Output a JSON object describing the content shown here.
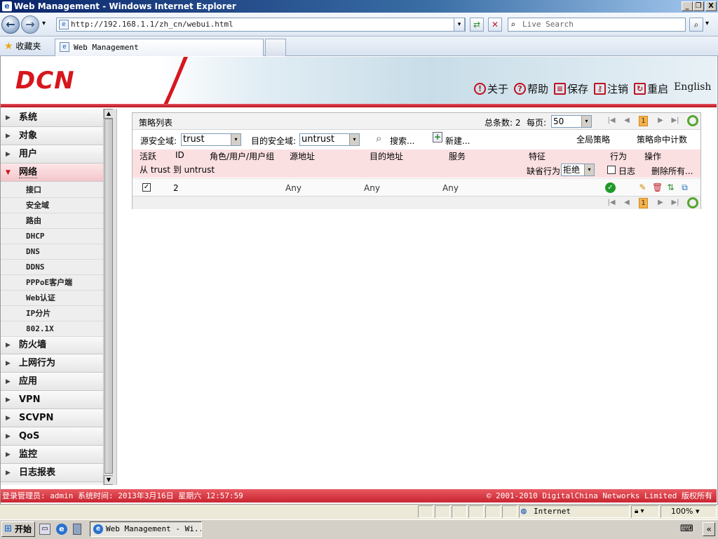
{
  "window": {
    "title": "Web Management - Windows Internet Explorer",
    "minimize": "_",
    "restore": "❐",
    "close": "X"
  },
  "browser": {
    "back": "←",
    "forward": "→",
    "history": "▾",
    "address": "http://192.168.1.1/zh_cn/webui.html",
    "address_icon": "e",
    "address_dropdown": "▾",
    "refresh": "⇄",
    "stop": "✕",
    "search_placeholder": "Live Search",
    "search_button": "⌕",
    "search_options": "▾",
    "favorites_label": "收藏夹",
    "favorites_icon": "★",
    "tab_title": "Web Management",
    "tab_icon": "e"
  },
  "header": {
    "logo": "DCN",
    "links": [
      {
        "icon": "!",
        "label": "关于"
      },
      {
        "icon": "?",
        "label": "帮助"
      },
      {
        "icon": "≡",
        "label": "保存"
      },
      {
        "icon": "⚷",
        "label": "注销"
      },
      {
        "icon": "↻",
        "label": "重启"
      }
    ],
    "language": "English"
  },
  "sidebar": {
    "items": [
      {
        "label": "系统",
        "arrow": "▶"
      },
      {
        "label": "对象",
        "arrow": "▶"
      },
      {
        "label": "用户",
        "arrow": "▶"
      },
      {
        "label": "网络",
        "arrow": "▼"
      },
      {
        "label": "防火墙",
        "arrow": "▶"
      },
      {
        "label": "上网行为",
        "arrow": "▶"
      },
      {
        "label": "应用",
        "arrow": "▶"
      },
      {
        "label": "VPN",
        "arrow": "▶"
      },
      {
        "label": "SCVPN",
        "arrow": "▶"
      },
      {
        "label": "QoS",
        "arrow": "▶"
      },
      {
        "label": "监控",
        "arrow": "▶"
      },
      {
        "label": "日志报表",
        "arrow": "▶"
      }
    ],
    "subitems": [
      "接口",
      "安全域",
      "路由",
      "DHCP",
      "DNS",
      "DDNS",
      "PPPoE客户端",
      "Web认证",
      "IP分片",
      "802.1X"
    ],
    "scroll_up": "▲",
    "scroll_down": "▼"
  },
  "policy": {
    "title": "策略列表",
    "total_label": "总条数: 2",
    "per_page_label": "每页:",
    "per_page_value": "50",
    "dropdown_arrow": "▾",
    "current_page": "1",
    "pager": {
      "first": "|◀",
      "prev": "◀",
      "next": "▶",
      "last": "▶|"
    },
    "src_zone_label": "源安全域:",
    "src_zone_value": "trust",
    "dst_zone_label": "目的安全域:",
    "dst_zone_value": "untrust",
    "search_icon": "⌕",
    "search_label": "搜索...",
    "new_icon": "+",
    "new_label": "新建...",
    "global_policy": "全局策略",
    "hit_count": "策略命中计数",
    "columns": [
      "活跃",
      "ID",
      "角色/用户/用户组",
      "源地址",
      "目的地址",
      "服务",
      "特征",
      "行为",
      "操作"
    ],
    "group_label": "从 trust 到 untrust",
    "default_action_label": "缺省行为",
    "default_action_value": "拒绝",
    "log_label": "日志",
    "delete_all": "删除所有...",
    "rows": [
      {
        "active": "✓",
        "id": "2",
        "src": "Any",
        "dst": "Any",
        "service": "Any",
        "action": "✓"
      }
    ],
    "op_icons": {
      "edit": "✎",
      "delete": "🗑",
      "move": "⇅",
      "copy": "⧉"
    }
  },
  "status": {
    "left": "登录管理员: admin 系统时间: 2013年3月16日 星期六 12:57:59",
    "right": "© 2001-2010 DigitalChina Networks Limited 版权所有"
  },
  "ie_status": {
    "zone": "Internet",
    "zoom": "100%",
    "zone_icon": "◍",
    "zoom_arrow": "▾"
  },
  "taskbar": {
    "start": "开始",
    "start_icon": "⊞",
    "item": "Web Management - Wi...",
    "item_icon": "e",
    "tray_icon": "⌨",
    "tray_expand": "«"
  }
}
